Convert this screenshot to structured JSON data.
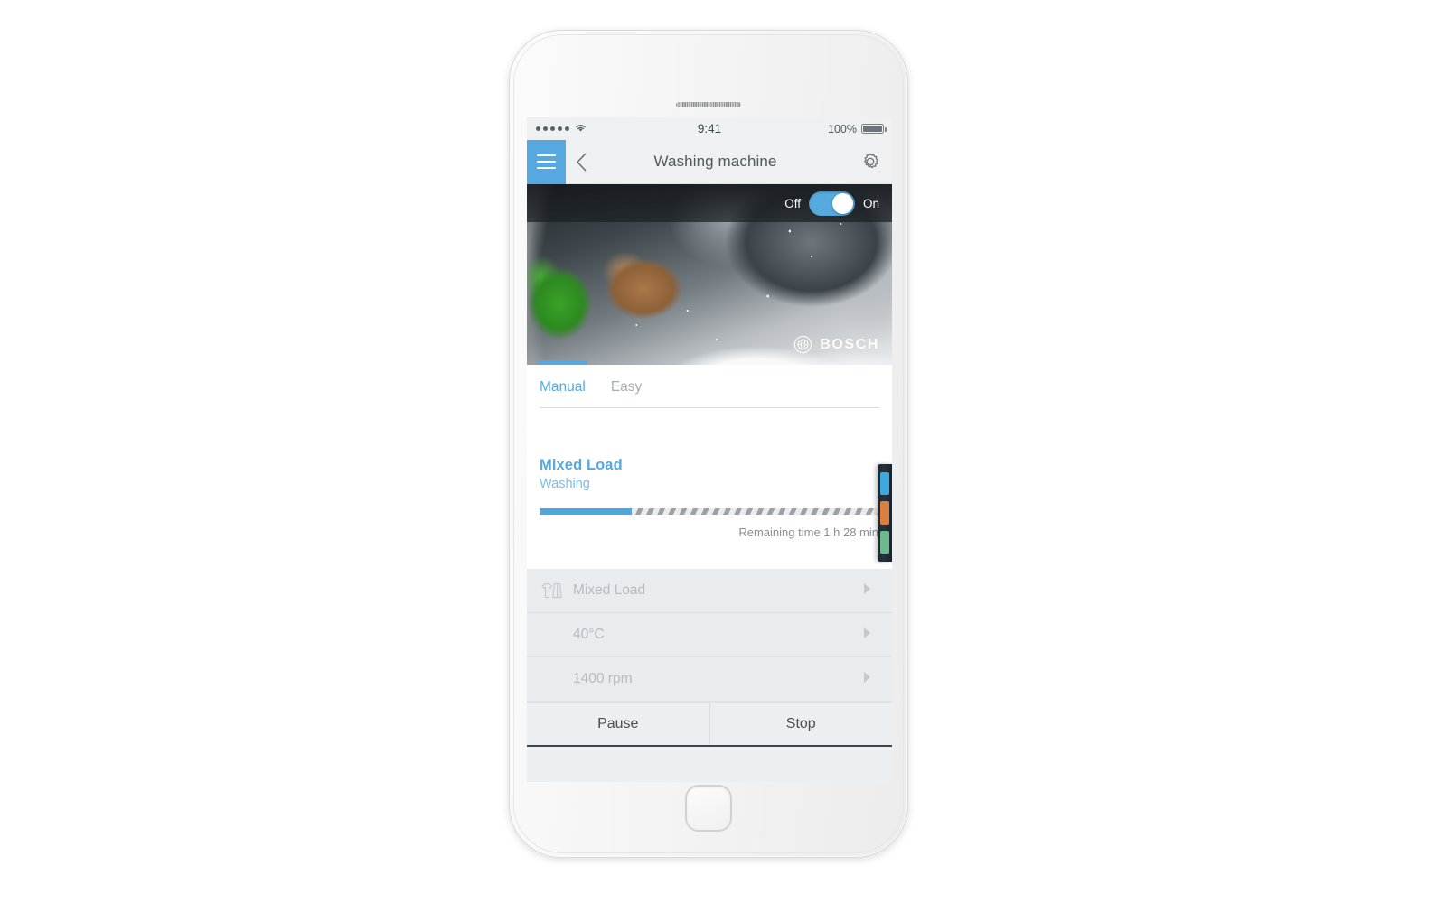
{
  "status_bar": {
    "signal_dots": 5,
    "wifi_icon": "wifi-icon",
    "time": "9:41",
    "battery_percent": "100%",
    "battery_icon": "battery-full-icon"
  },
  "nav_bar": {
    "menu_icon": "hamburger-menu-icon",
    "back_icon": "chevron-left-icon",
    "title": "Washing machine",
    "settings_icon": "gear-icon",
    "accent_color": "#56a9e0"
  },
  "hero": {
    "toggle": {
      "off_label": "Off",
      "on_label": "On",
      "state": "on",
      "track_color": "#57aade"
    },
    "brand": "BOSCH",
    "brand_mark": "bosch-circle-logo"
  },
  "tabs": [
    {
      "label": "Manual",
      "active": true
    },
    {
      "label": "Easy",
      "active": false
    }
  ],
  "program": {
    "name": "Mixed Load",
    "state": "Washing",
    "progress_percent": 27,
    "remaining_time": "Remaining time 1 h 28 min",
    "name_color": "#56a9e0",
    "fill_color": "#4fa6de"
  },
  "settings_rows": [
    {
      "icon": "laundry-garments-icon",
      "label": "Mixed Load",
      "chevron": "chevron-right-icon"
    },
    {
      "icon": "",
      "label": "40°C",
      "chevron": "chevron-right-icon"
    },
    {
      "icon": "",
      "label": "1400 rpm",
      "chevron": "chevron-right-icon"
    }
  ],
  "actions": {
    "pause_label": "Pause",
    "stop_label": "Stop"
  },
  "peek_panel": {
    "bars": [
      {
        "name": "blue-bar",
        "color": "#3da9dc"
      },
      {
        "name": "orange-bar",
        "color": "#d98040"
      },
      {
        "name": "green-bar",
        "color": "#6db88f"
      }
    ]
  }
}
